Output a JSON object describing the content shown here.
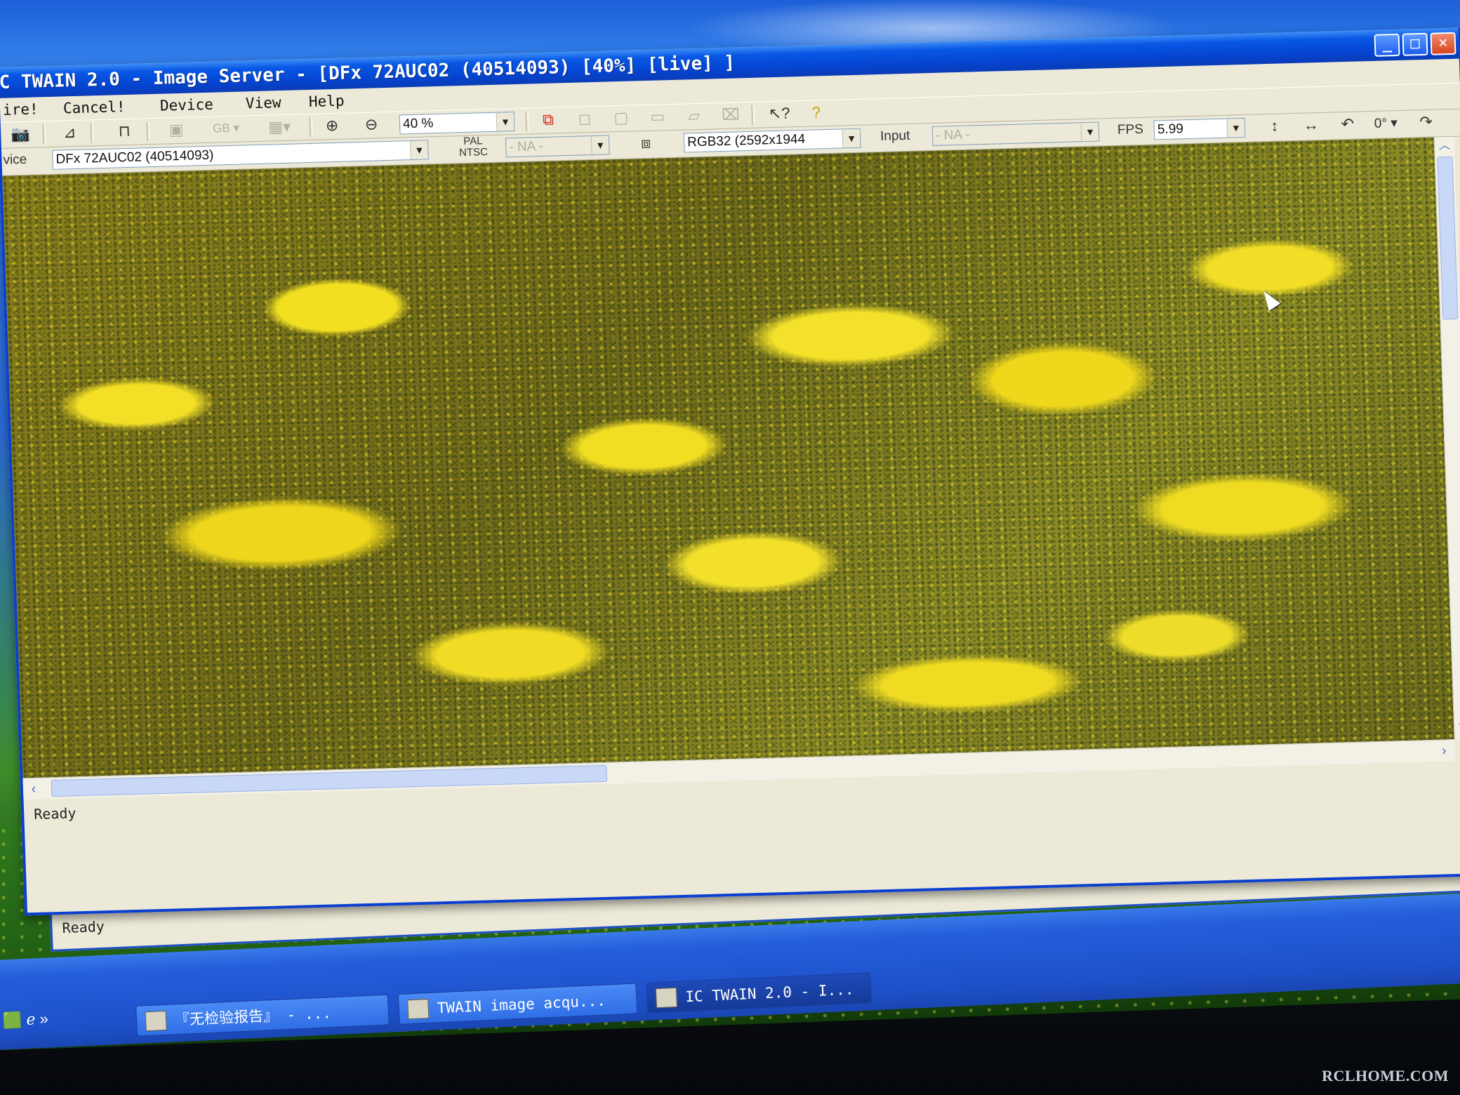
{
  "window": {
    "title": "C TWAIN 2.0 - Image Server - [DFx 72AUC02 (40514093) [40%]  [live] ]",
    "minimize_glyph": "_",
    "maximize_glyph": "□",
    "close_glyph": "✕"
  },
  "menu": {
    "items": [
      "ire!",
      "Cancel!",
      "Device",
      "View",
      "Help"
    ]
  },
  "toolbar1": {
    "zoom_value": "40 %",
    "gb_label": "GB",
    "icons": [
      "camera-icon",
      "histogram-icon",
      "trigger-icon",
      "properties-icon",
      "grid-icon",
      "zoom-in-icon",
      "zoom-out-icon",
      "snapshot-icon",
      "context-help-icon",
      "help-icon"
    ]
  },
  "toolbar2": {
    "device_label": "vice",
    "device_value": "DFx 72AUC02 (40514093)",
    "video_norm_label": "PAL NTSC",
    "video_norm_value": "- NA -",
    "format_value": "RGB32 (2592x1944",
    "input_label": "Input",
    "input_value": "- NA -",
    "fps_label": "FPS",
    "fps_value": "5.99",
    "rotation_value": "0°"
  },
  "status": {
    "text": "Ready"
  },
  "back_window": {
    "status": "Ready"
  },
  "taskbar": {
    "tasks": [
      "『无检验报告』 - ...",
      "TWAIN image acqu...",
      "IC TWAIN 2.0 - I..."
    ],
    "more_glyph": "»"
  },
  "watermark": "RCLHOME.COM",
  "colors": {
    "titlebar": "#0858e5",
    "window_face": "#ece9d8",
    "image_yellow": "#f2e020"
  }
}
